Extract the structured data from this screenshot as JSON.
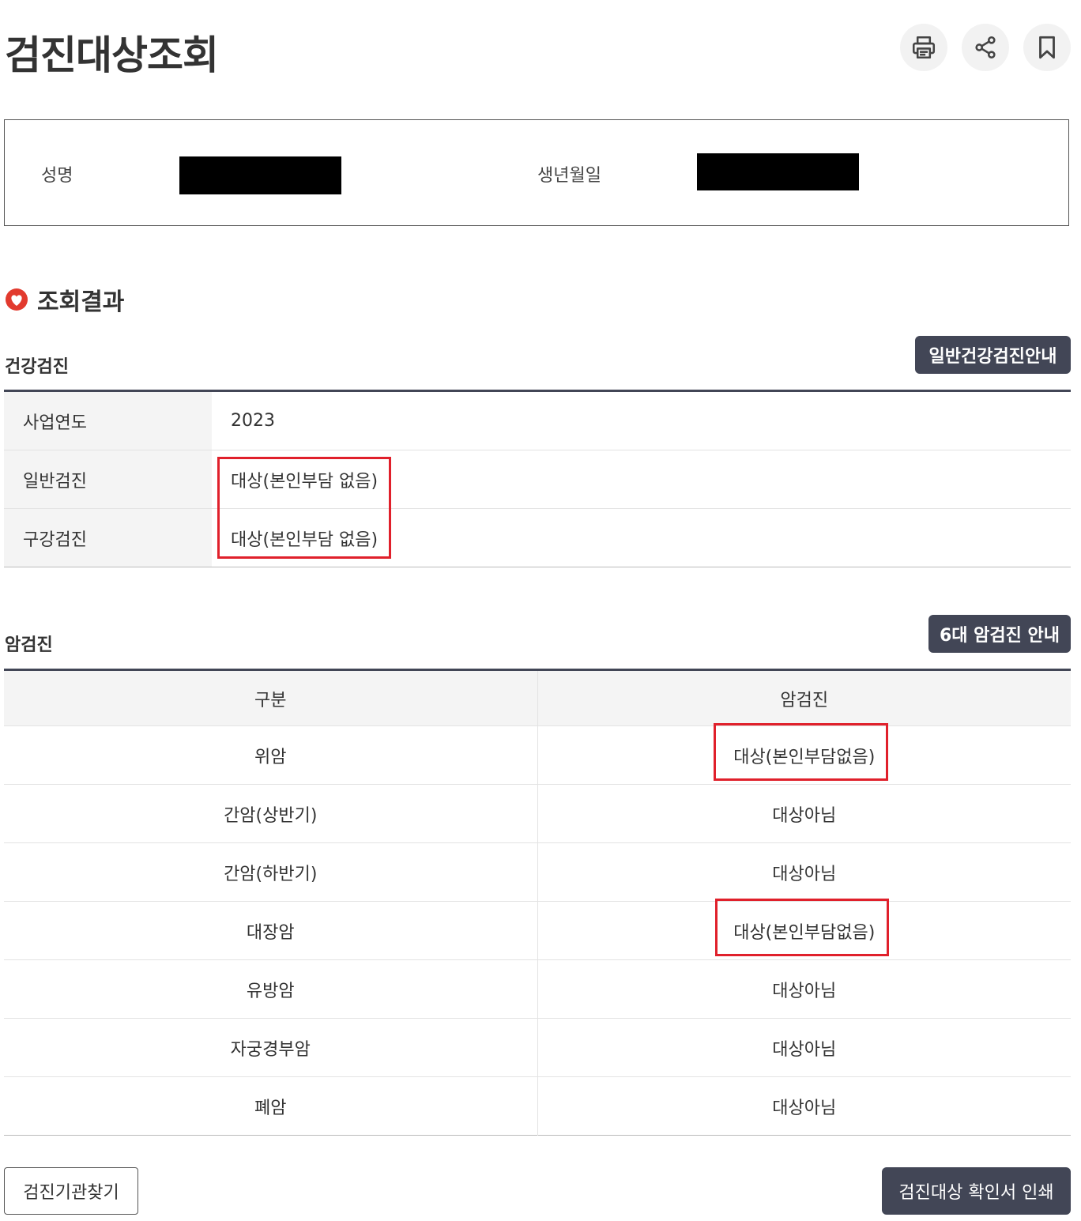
{
  "page": {
    "title": "검진대상조회"
  },
  "toolbar": {
    "print_icon": "printer-icon",
    "share_icon": "share-icon",
    "bookmark_icon": "bookmark-icon"
  },
  "person": {
    "name_label": "성명",
    "birth_label": "생년월일"
  },
  "results": {
    "title": "조회결과",
    "icon": "heart-badge-icon"
  },
  "health": {
    "title": "건강검진",
    "guide_button": "일반건강검진안내",
    "rows": [
      {
        "label": "사업연도",
        "value": "2023"
      },
      {
        "label": "일반검진",
        "value": "대상(본인부담 없음)"
      },
      {
        "label": "구강검진",
        "value": "대상(본인부담 없음)"
      }
    ]
  },
  "cancer": {
    "title": "암검진",
    "guide_button": "6대 암검진 안내",
    "headers": [
      "구분",
      "암검진"
    ],
    "rows": [
      {
        "type": "위암",
        "status": "대상(본인부담없음)"
      },
      {
        "type": "간암(상반기)",
        "status": "대상아님"
      },
      {
        "type": "간암(하반기)",
        "status": "대상아님"
      },
      {
        "type": "대장암",
        "status": "대상(본인부담없음)"
      },
      {
        "type": "유방암",
        "status": "대상아님"
      },
      {
        "type": "자궁경부암",
        "status": "대상아님"
      },
      {
        "type": "폐암",
        "status": "대상아님"
      }
    ]
  },
  "footer": {
    "find_institution_button": "검진기관찾기",
    "print_certificate_button": "검진대상 확인서 인쇄"
  },
  "colors": {
    "primary_dark": "#424656",
    "highlight_red": "#e0202b",
    "heart_red": "#e23a2e"
  }
}
